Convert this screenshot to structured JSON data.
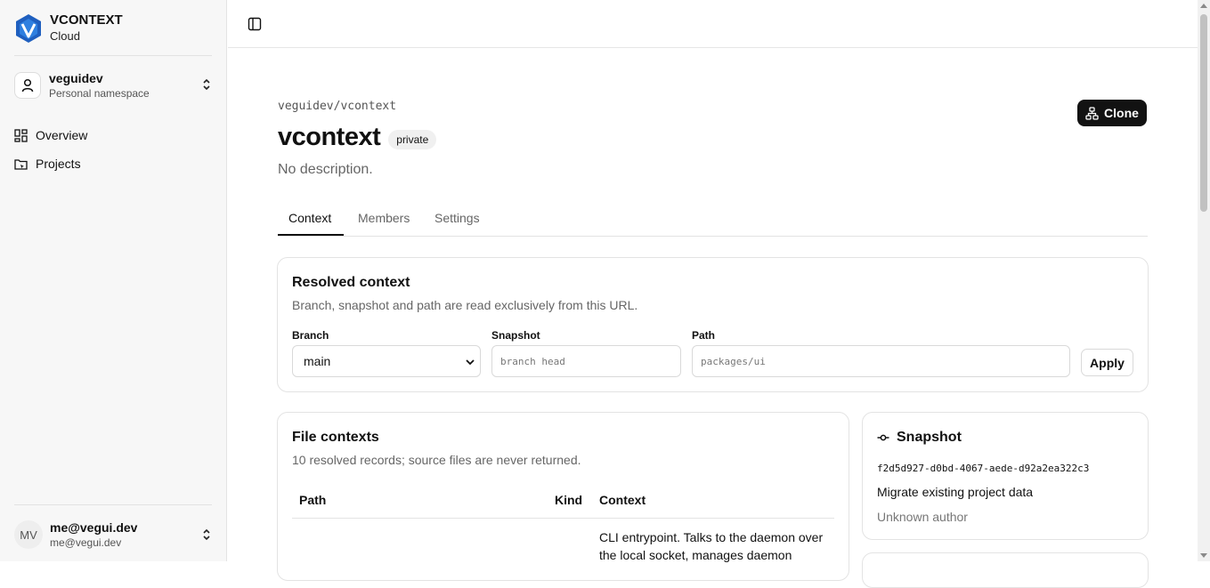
{
  "brand": {
    "name": "VCONTEXT",
    "subtitle": "Cloud",
    "logo_icon": "vcontext-logo"
  },
  "namespace": {
    "name": "veguidev",
    "subtitle": "Personal namespace"
  },
  "nav": [
    {
      "label": "Overview",
      "icon": "grid-icon"
    },
    {
      "label": "Projects",
      "icon": "projects-icon"
    }
  ],
  "user": {
    "initials": "MV",
    "name": "me@vegui.dev",
    "email": "me@vegui.dev"
  },
  "project": {
    "breadcrumb": "veguidev/vcontext",
    "name": "vcontext",
    "visibility": "private",
    "description": "No description.",
    "clone_label": "Clone"
  },
  "tabs": [
    {
      "label": "Context",
      "active": true
    },
    {
      "label": "Members",
      "active": false
    },
    {
      "label": "Settings",
      "active": false
    }
  ],
  "resolved_context": {
    "title": "Resolved context",
    "subtitle": "Branch, snapshot and path are read exclusively from this URL.",
    "branch": {
      "label": "Branch",
      "value": "main"
    },
    "snapshot": {
      "label": "Snapshot",
      "placeholder": "branch head"
    },
    "path": {
      "label": "Path",
      "placeholder": "packages/ui"
    },
    "apply_label": "Apply"
  },
  "file_contexts": {
    "title": "File contexts",
    "subtitle": "10 resolved records; source files are never returned.",
    "columns": [
      "Path",
      "Kind",
      "Context"
    ],
    "rows": [
      {
        "path": "",
        "kind": "",
        "context": "CLI entrypoint. Talks to the daemon over the local socket, manages daemon"
      }
    ]
  },
  "snapshot": {
    "title": "Snapshot",
    "id": "f2d5d927-d0bd-4067-aede-d92a2ea322c3",
    "message": "Migrate existing project data",
    "author": "Unknown author"
  },
  "colors": {
    "accent": "#121212",
    "sidebar_bg": "#f7f7f7",
    "border": "#e3e3e3",
    "muted_text": "#666666"
  }
}
